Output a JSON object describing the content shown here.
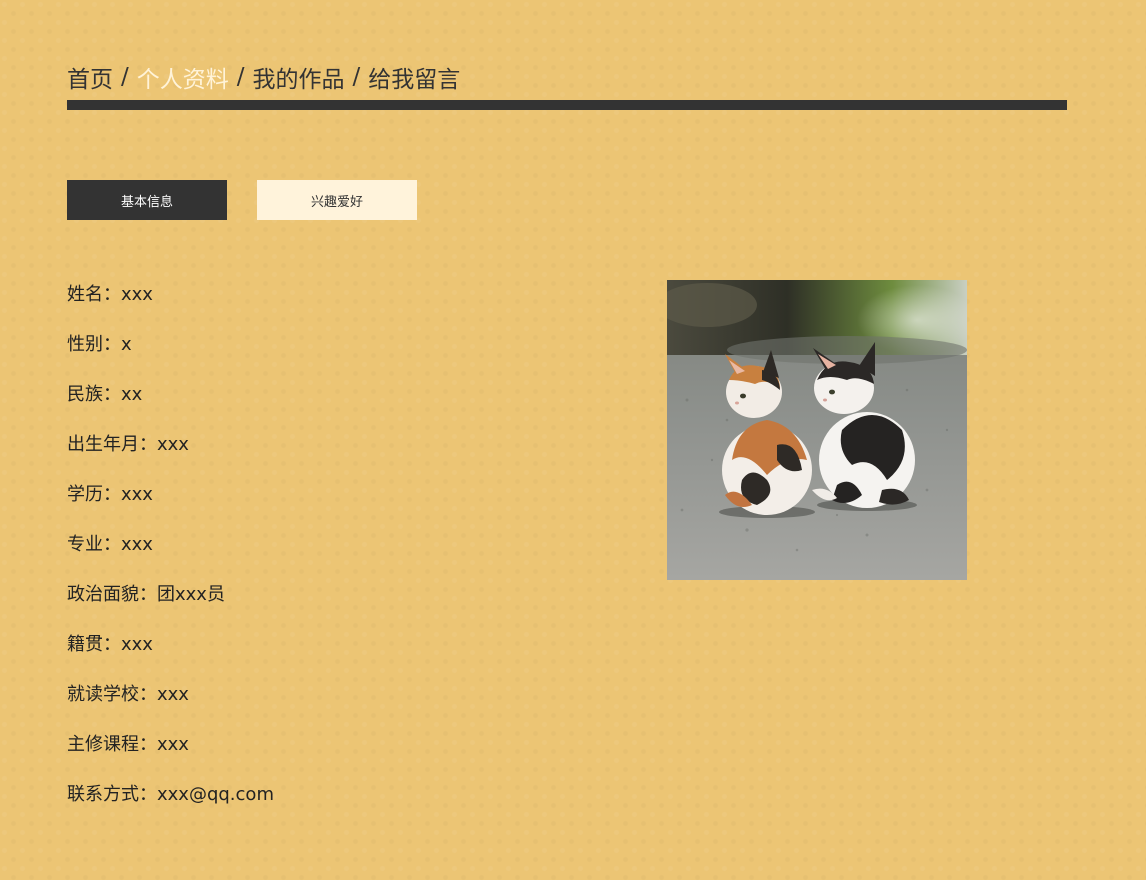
{
  "nav": {
    "items": [
      {
        "label": "首页",
        "active": false
      },
      {
        "label": "个人资料",
        "active": true
      },
      {
        "label": "我的作品",
        "active": false
      },
      {
        "label": "给我留言",
        "active": false
      }
    ],
    "separator": "/"
  },
  "tabs": [
    {
      "label": "基本信息",
      "selected": true
    },
    {
      "label": "兴趣爱好",
      "selected": false
    }
  ],
  "info": [
    "姓名：xxx",
    "性别：x",
    "民族：xx",
    "出生年月：xxx",
    "学历：xxx",
    "专业：xxx",
    "政治面貌：团xxx员",
    "籍贯：xxx",
    "就读学校：xxx",
    "主修课程：xxx",
    "联系方式：xxx@qq.com"
  ],
  "photo": {
    "subject": "two-kittens-photo"
  },
  "colors": {
    "background": "#ecc574",
    "dark": "#333333",
    "active_nav": "#fff3d8",
    "light_tab": "#fff3db"
  }
}
